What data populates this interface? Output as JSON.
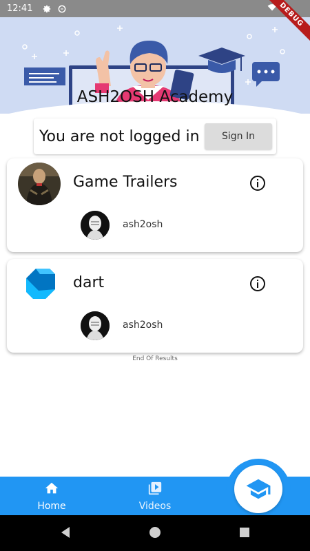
{
  "status_bar": {
    "time": "12:41"
  },
  "debug_banner": "DEBUG",
  "header": {
    "title": "ASH2OSH Academy"
  },
  "login": {
    "message": "You are not logged in",
    "button_label": "Sign In"
  },
  "channels": [
    {
      "title": "Game Trailers",
      "author": "ash2osh",
      "thumb_icon": "game-trailers-thumbnail"
    },
    {
      "title": "dart",
      "author": "ash2osh",
      "thumb_icon": "dart-logo"
    }
  ],
  "end_text": "End Of Results",
  "bottom_nav": {
    "items": [
      {
        "label": "Home",
        "icon": "home-icon"
      },
      {
        "label": "Videos",
        "icon": "video-library-icon"
      }
    ],
    "fab_icon": "graduation-cap-icon"
  },
  "colors": {
    "primary": "#2196f3",
    "banner_bg": "#cfdbf3",
    "debug": "#b71c1c"
  }
}
